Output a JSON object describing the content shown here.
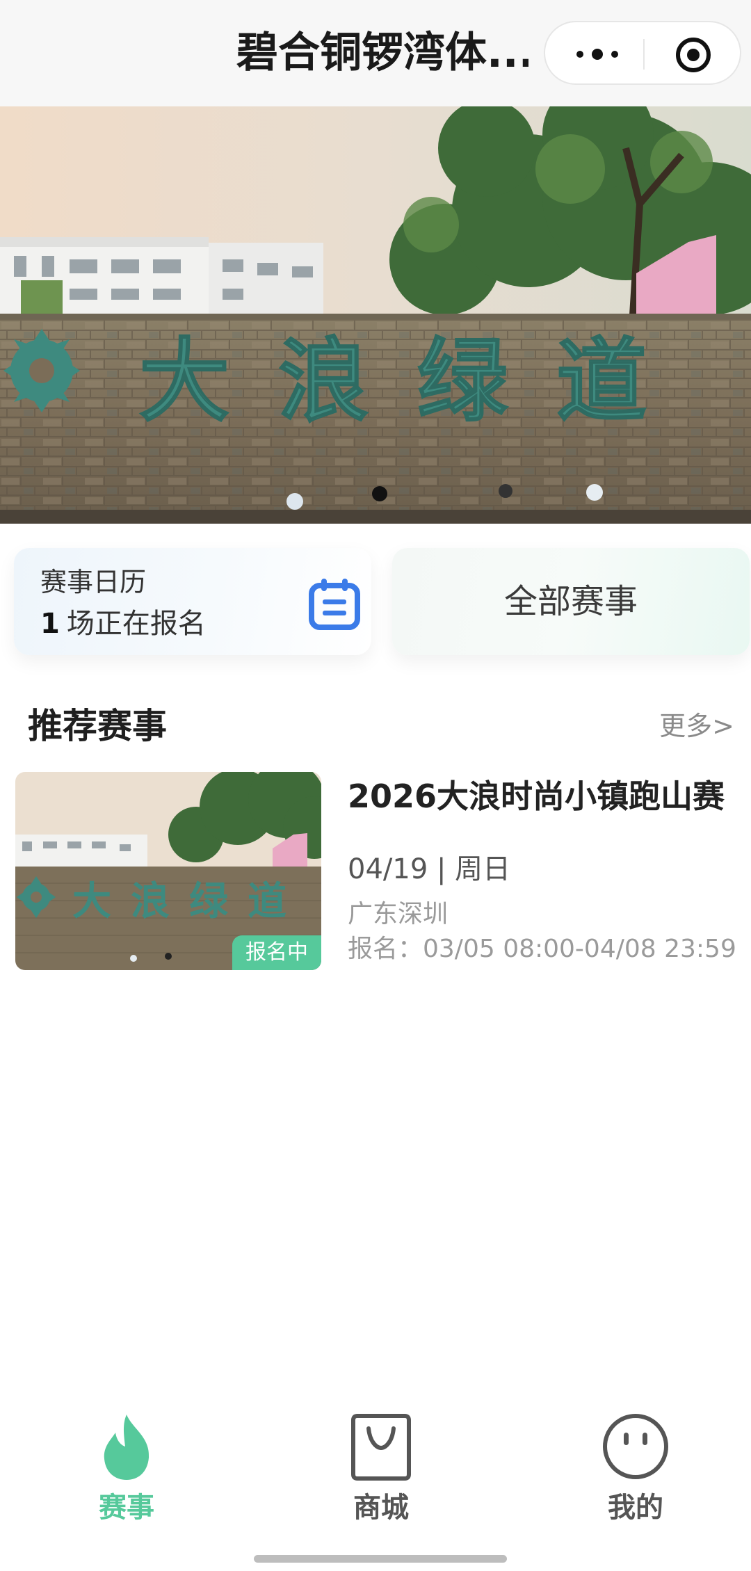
{
  "header": {
    "title": "碧合铜锣湾体...",
    "more_icon": "more-dots-icon",
    "close_icon": "target-circle-icon"
  },
  "banner": {
    "sign_text": "大浪绿道"
  },
  "cards": {
    "calendar": {
      "title": "赛事日历",
      "count": "1",
      "status": "场正在报名",
      "icon": "calendar-icon"
    },
    "all_events": {
      "label": "全部赛事"
    }
  },
  "recommended": {
    "title": "推荐赛事",
    "more": "更多>",
    "items": [
      {
        "title": "2026大浪时尚小镇跑山赛",
        "date": "04/19 | 周日",
        "location": "广东深圳",
        "registration": "报名：03/05 08:00-04/08 23:59",
        "badge": "报名中",
        "thumb_sign_text": "大浪绿道"
      }
    ]
  },
  "tabbar": {
    "items": [
      {
        "label": "赛事",
        "icon": "flame-icon",
        "active": true
      },
      {
        "label": "商城",
        "icon": "shopping-bag-icon",
        "active": false
      },
      {
        "label": "我的",
        "icon": "smiley-face-icon",
        "active": false
      }
    ]
  },
  "colors": {
    "accent": "#56c99b",
    "calendar_blue": "#3b7be8",
    "inactive_tab": "#555555"
  }
}
